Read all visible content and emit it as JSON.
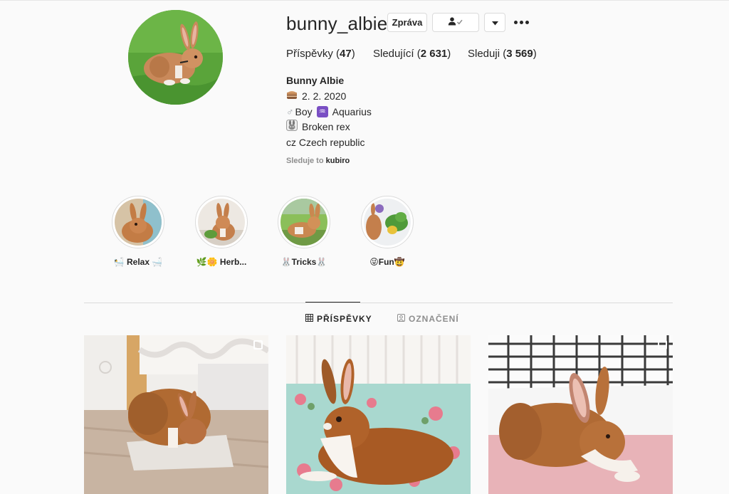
{
  "profile": {
    "username": "bunny_albie",
    "buttons": {
      "message": "Zpráva"
    },
    "stats": {
      "posts_label": "Příspěvky",
      "posts_count": "47",
      "followers_label": "Sledující",
      "followers_count": "2 631",
      "following_label": "Sleduji",
      "following_count": "3 569"
    },
    "bio": {
      "name": "Bunny Albie",
      "birthday": "2. 2. 2020",
      "gender_sign": "♂",
      "gender_text": "Boy",
      "zodiac_sign": "♒",
      "zodiac_text": "Aquarius",
      "breed": "Broken rex",
      "country": "cz Czech republic"
    },
    "followed_by": {
      "label": "Sleduje to",
      "user": "kubiro"
    }
  },
  "highlights": [
    {
      "label": "🛀 Relax 🛁"
    },
    {
      "label": "🌿🌼 Herb..."
    },
    {
      "label": "🐰Tricks🐰"
    },
    {
      "label": "😜Fun🤠"
    }
  ],
  "tabs": {
    "posts": "PŘÍSPĚVKY",
    "tagged": "OZNAČENÍ"
  },
  "icons": {
    "more": "more-options-icon",
    "follow_status": "person-check-icon",
    "dropdown": "chevron-down-icon",
    "grid": "grid-icon",
    "tagged": "tagged-icon",
    "multi_post": "carousel-icon"
  },
  "colors": {
    "accent": "#262626",
    "muted": "#8e8e8e",
    "border": "#dbdbdb",
    "background": "#fafafa"
  }
}
